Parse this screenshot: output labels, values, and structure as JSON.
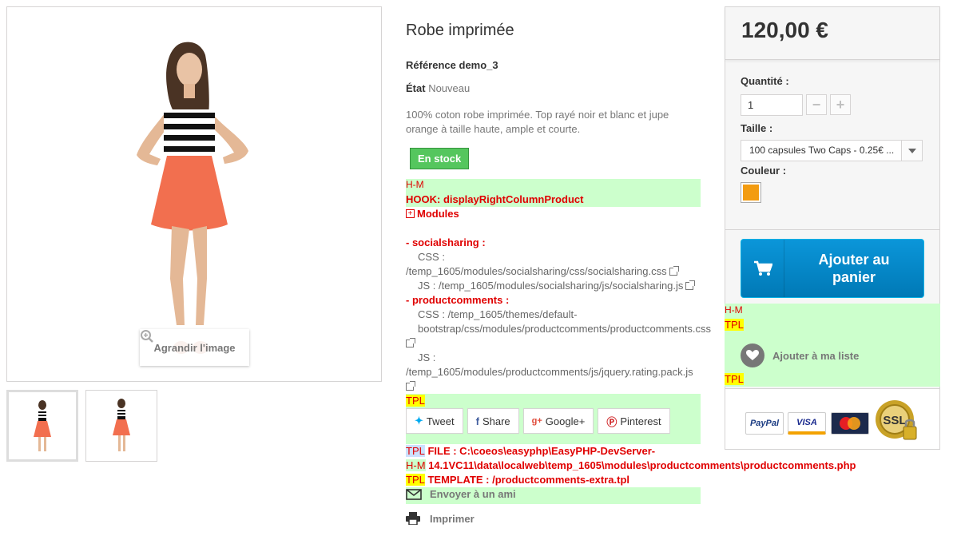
{
  "product": {
    "image_zoom_label": "Agrandir l'image",
    "title": "Robe imprimée",
    "reference_label": "Référence",
    "reference_value": "demo_3",
    "condition_label": "État",
    "condition_value": "Nouveau",
    "description": "100% coton robe imprimée. Top rayé noir et blanc et jupe orange à taille haute, ample et courte.",
    "stock_badge": "En stock"
  },
  "debug": {
    "hm": "H-M",
    "hook": "HOOK: displayRightColumnProduct",
    "modules_label": "Modules",
    "socialsharing_name": "- socialsharing :",
    "socialsharing_css_label": "CSS :",
    "socialsharing_css": "/temp_1605/modules/socialsharing/css/socialsharing.css",
    "socialsharing_js_label": "JS :",
    "socialsharing_js": "/temp_1605/modules/socialsharing/js/socialsharing.js",
    "productcomments_name": "- productcomments :",
    "productcomments_css_label": "CSS :",
    "productcomments_css": "/temp_1605/themes/default-bootstrap/css/modules/productcomments/productcomments.css",
    "productcomments_js_label": "JS :",
    "productcomments_js": "/temp_1605/modules/productcomments/js/jquery.rating.pack.js",
    "tpl": "TPL",
    "file_line1": "FILE : C:\\coeos\\easyphp\\EasyPHP-DevServer-",
    "file_line2": "14.1VC11\\data\\localweb\\temp_1605\\modules\\productcomments\\productcomments.php",
    "template_line": "TEMPLATE : /productcomments-extra.tpl"
  },
  "share": {
    "tweet": "Tweet",
    "share": "Share",
    "googleplus": "Google+",
    "pinterest": "Pinterest"
  },
  "actions": {
    "send_friend": "Envoyer à un ami",
    "print": "Imprimer",
    "wishlist": "Ajouter à ma liste"
  },
  "buy_box": {
    "price": "120,00 €",
    "quantity_label": "Quantité :",
    "quantity_value": "1",
    "size_label": "Taille :",
    "size_value": "100 capsules Two Caps - 0.25€ ...",
    "color_label": "Couleur :",
    "color_value": "#f39c11",
    "add_to_cart_line1": "Ajouter au",
    "add_to_cart_line2": "panier"
  },
  "payments": [
    "PayPal",
    "VISA",
    "MasterCard",
    "SSL"
  ],
  "colors": {
    "accent_blue": "#0079b6",
    "stock_green": "#55c65e",
    "debug_green": "#ccffcc",
    "debug_red": "#e00000"
  }
}
